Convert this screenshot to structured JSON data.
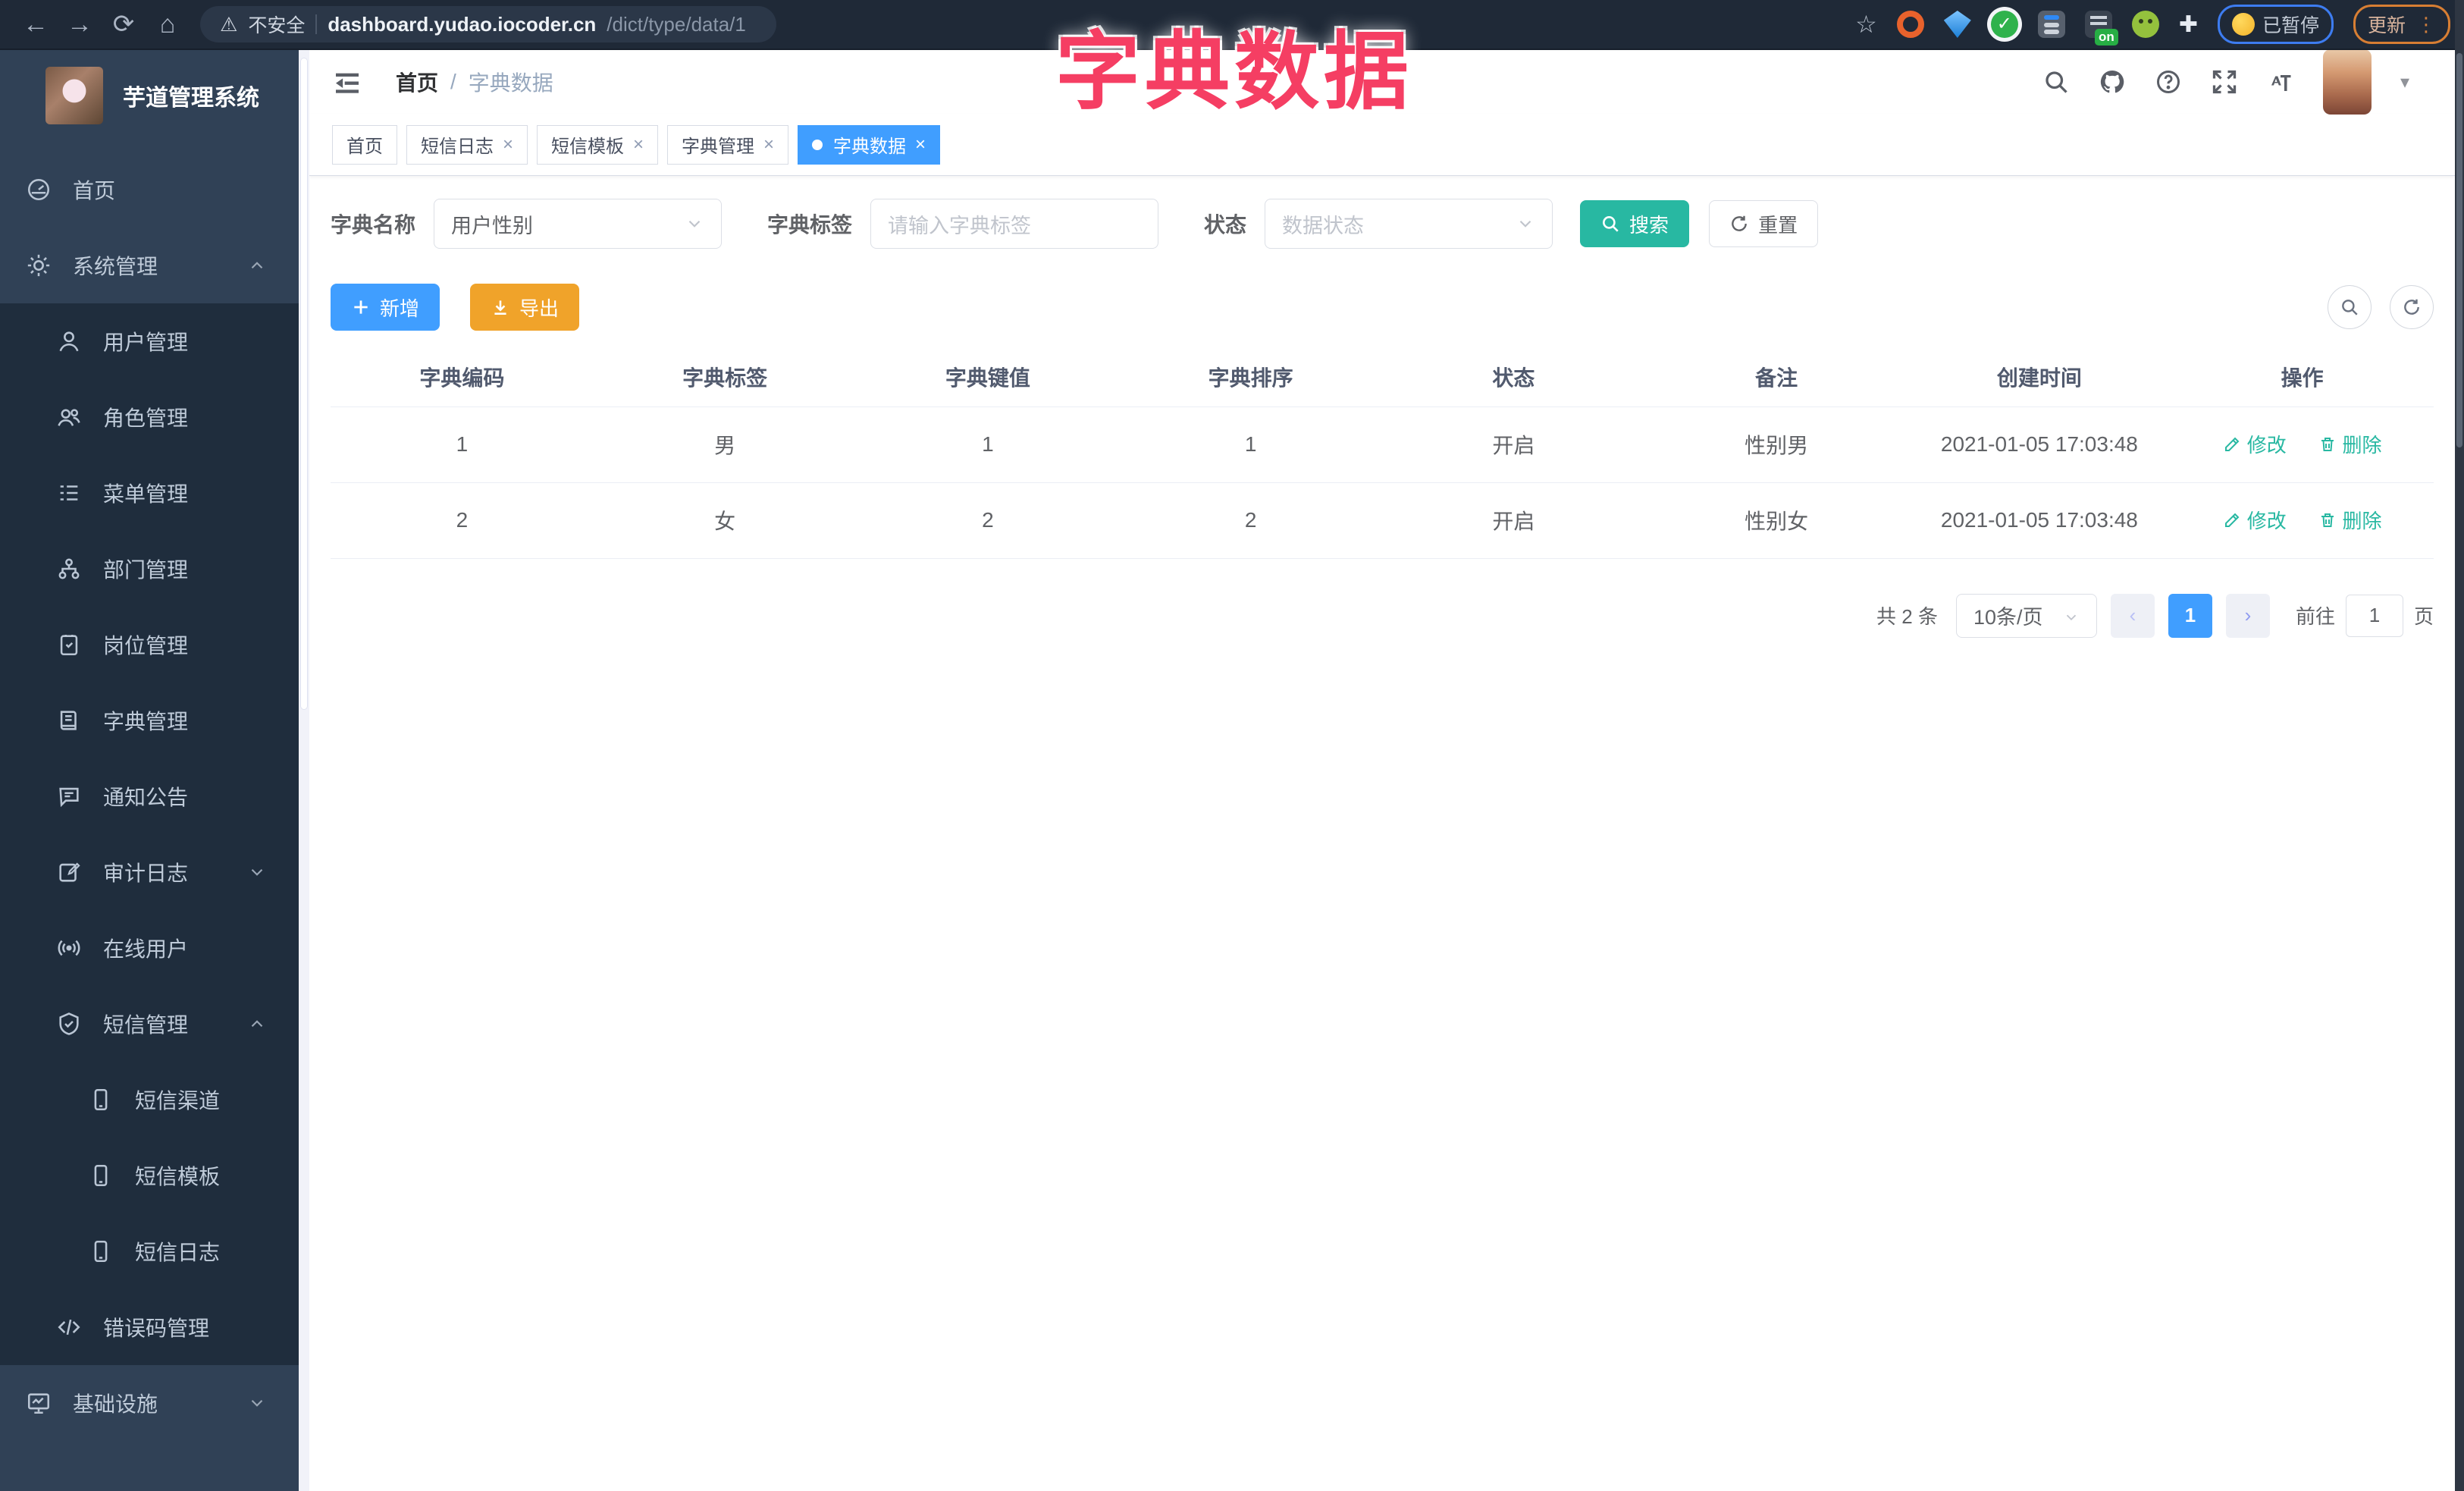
{
  "browser": {
    "security_label": "不安全",
    "url_host": "dashboard.yudao.iocoder.cn",
    "url_path": "/dict/type/data/1",
    "paused_label": "已暂停",
    "update_label": "更新",
    "on_badge": "on"
  },
  "glyphs": {
    "back": "←",
    "forward": "→",
    "reload": "⟳",
    "home": "⌂",
    "warning": "⚠",
    "star": "☆",
    "dots": "⋮",
    "close": "×",
    "check": "✓",
    "puzzle": "✚",
    "caret_down": "▾",
    "prev": "‹",
    "next": "›"
  },
  "overlay": {
    "title": "字典数据"
  },
  "sidebar": {
    "logo_title": "芋道管理系统",
    "items": [
      {
        "label": "首页"
      },
      {
        "label": "系统管理"
      },
      {
        "label": "用户管理"
      },
      {
        "label": "角色管理"
      },
      {
        "label": "菜单管理"
      },
      {
        "label": "部门管理"
      },
      {
        "label": "岗位管理"
      },
      {
        "label": "字典管理"
      },
      {
        "label": "通知公告"
      },
      {
        "label": "审计日志"
      },
      {
        "label": "在线用户"
      },
      {
        "label": "短信管理"
      },
      {
        "label": "短信渠道"
      },
      {
        "label": "短信模板"
      },
      {
        "label": "短信日志"
      },
      {
        "label": "错误码管理"
      },
      {
        "label": "基础设施"
      }
    ]
  },
  "header": {
    "breadcrumb_home": "首页",
    "breadcrumb_separator": "/",
    "breadcrumb_current": "字典数据"
  },
  "tabs": [
    {
      "label": "首页"
    },
    {
      "label": "短信日志"
    },
    {
      "label": "短信模板"
    },
    {
      "label": "字典管理"
    },
    {
      "label": "字典数据"
    }
  ],
  "filters": {
    "dict_name_label": "字典名称",
    "dict_name_value": "用户性别",
    "dict_label_label": "字典标签",
    "dict_label_placeholder": "请输入字典标签",
    "status_label": "状态",
    "status_placeholder": "数据状态",
    "search_label": "搜索",
    "reset_label": "重置"
  },
  "toolbar": {
    "add_label": "新增",
    "export_label": "导出"
  },
  "table": {
    "headers": [
      "字典编码",
      "字典标签",
      "字典键值",
      "字典排序",
      "状态",
      "备注",
      "创建时间",
      "操作"
    ],
    "rows": [
      {
        "code": "1",
        "label": "男",
        "value": "1",
        "sort": "1",
        "status": "开启",
        "remark": "性别男",
        "created": "2021-01-05 17:03:48"
      },
      {
        "code": "2",
        "label": "女",
        "value": "2",
        "sort": "2",
        "status": "开启",
        "remark": "性别女",
        "created": "2021-01-05 17:03:48"
      }
    ],
    "edit_label": "修改",
    "delete_label": "删除"
  },
  "pagination": {
    "total_text": "共 2 条",
    "page_size": "10条/页",
    "current_page": "1",
    "goto_label": "前往",
    "goto_value": "1",
    "page_suffix": "页"
  },
  "colors": {
    "accent_blue": "#409eff",
    "accent_teal": "#28b8a2",
    "accent_orange": "#f0a32a",
    "overlay_pink": "#f53e63",
    "sidebar_bg": "#304156",
    "submenu_bg": "#1f2d3d"
  }
}
